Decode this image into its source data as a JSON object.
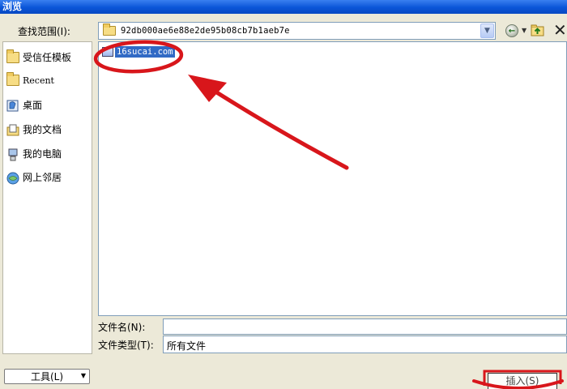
{
  "window": {
    "title": "浏览"
  },
  "look_in": {
    "label": "查找范围(I):",
    "path": "92db000ae6e88e2de95b08cb7b1aeb7e"
  },
  "places": [
    {
      "label": "受信任模板",
      "icon": "folder-icon"
    },
    {
      "label": "Recent",
      "icon": "folder-icon"
    },
    {
      "label": "桌面",
      "icon": "desktop-icon"
    },
    {
      "label": "我的文档",
      "icon": "documents-icon"
    },
    {
      "label": "我的电脑",
      "icon": "computer-icon"
    },
    {
      "label": "网上邻居",
      "icon": "network-icon"
    }
  ],
  "files": [
    {
      "name": "16sucai.com",
      "selected": true
    }
  ],
  "file_name": {
    "label": "文件名(N):",
    "value": ""
  },
  "file_type": {
    "label": "文件类型(T):",
    "value": "所有文件"
  },
  "buttons": {
    "tools": "工具(L)",
    "insert": "插入(S)"
  },
  "colors": {
    "title_bar": "#0a55d8",
    "selection": "#316ac5",
    "annotation": "#d8161b"
  }
}
